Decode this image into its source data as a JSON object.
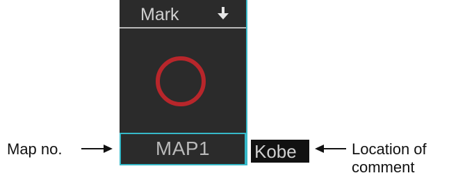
{
  "mark_panel": {
    "title": "Mark",
    "header_icon": "arrow-down-icon",
    "mark_symbol": "circle",
    "mark_color": "#b8262b",
    "map_no": "MAP1"
  },
  "comment": {
    "text": "Kobe"
  },
  "callouts": {
    "map_no_label": "Map no.",
    "location_label_line1": "Location of",
    "location_label_line2": "comment"
  },
  "colors": {
    "panel_bg": "#2b2b2b",
    "accent_cyan": "#36b9c9",
    "text_gray": "#b9b9b9"
  }
}
